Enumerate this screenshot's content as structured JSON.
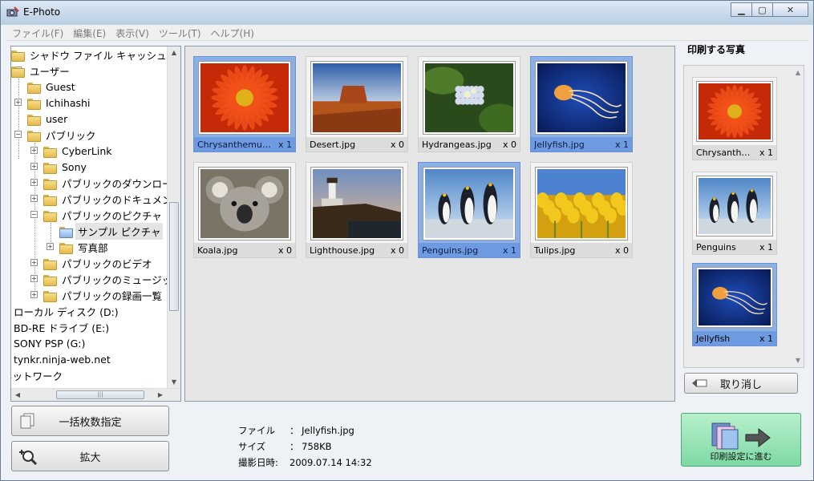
{
  "window": {
    "title": "E-Photo"
  },
  "menu": [
    "ファイル(F)",
    "編集(E)",
    "表示(V)",
    "ツール(T)",
    "ヘルプ(H)"
  ],
  "tree": [
    {
      "label": "シャドウ ファイル キャッシュ"
    },
    {
      "label": "ユーザー"
    },
    {
      "label": "Guest"
    },
    {
      "label": "Ichihashi"
    },
    {
      "label": "user"
    },
    {
      "label": "パブリック"
    },
    {
      "label": "CyberLink"
    },
    {
      "label": "Sony"
    },
    {
      "label": "パブリックのダウンロード"
    },
    {
      "label": "パブリックのドキュメント"
    },
    {
      "label": "パブリックのピクチャ"
    },
    {
      "label": "サンプル ピクチャ"
    },
    {
      "label": "写真部"
    },
    {
      "label": "パブリックのビデオ"
    },
    {
      "label": "パブリックのミュージック"
    },
    {
      "label": "パブリックの録画一覧"
    },
    {
      "label": "ローカル ディスク (D:)"
    },
    {
      "label": "BD-RE ドライブ (E:)"
    },
    {
      "label": "SONY PSP (G:)"
    },
    {
      "label": "tynkr.ninja-web.net"
    },
    {
      "label": "ネットワーク"
    }
  ],
  "gallery": [
    {
      "name": "Chrysanthemu…",
      "count": "x 1",
      "selected": true,
      "image": "chrysanthemum"
    },
    {
      "name": "Desert.jpg",
      "count": "x 0",
      "selected": false,
      "image": "desert"
    },
    {
      "name": "Hydrangeas.jpg",
      "count": "x 0",
      "selected": false,
      "image": "hydrangeas"
    },
    {
      "name": "Jellyfish.jpg",
      "count": "x 1",
      "selected": true,
      "image": "jellyfish"
    },
    {
      "name": "Koala.jpg",
      "count": "x 0",
      "selected": false,
      "image": "koala"
    },
    {
      "name": "Lighthouse.jpg",
      "count": "x 0",
      "selected": false,
      "image": "lighthouse"
    },
    {
      "name": "Penguins.jpg",
      "count": "x 1",
      "selected": true,
      "image": "penguins"
    },
    {
      "name": "Tulips.jpg",
      "count": "x 0",
      "selected": false,
      "image": "tulips"
    }
  ],
  "print_panel": {
    "title": "印刷する写真",
    "items": [
      {
        "name": "Chrysanth…",
        "count": "x 1",
        "selected": false,
        "image": "chrysanthemum"
      },
      {
        "name": "Penguins",
        "count": "x 1",
        "selected": false,
        "image": "penguins"
      },
      {
        "name": "Jellyfish",
        "count": "x 1",
        "selected": true,
        "image": "jellyfish"
      }
    ],
    "cancel_label": "取り消し"
  },
  "buttons": {
    "bulk_count": "一括枚数指定",
    "zoom": "拡大",
    "proceed": "印刷設定に進む"
  },
  "info": {
    "file_label": "ファイル",
    "file_value": "Jellyfish.jpg",
    "size_label": "サイズ",
    "size_value": "758KB",
    "date_label": "撮影日時:",
    "date_value": "2009.07.14  14:32",
    "sep": "："
  }
}
